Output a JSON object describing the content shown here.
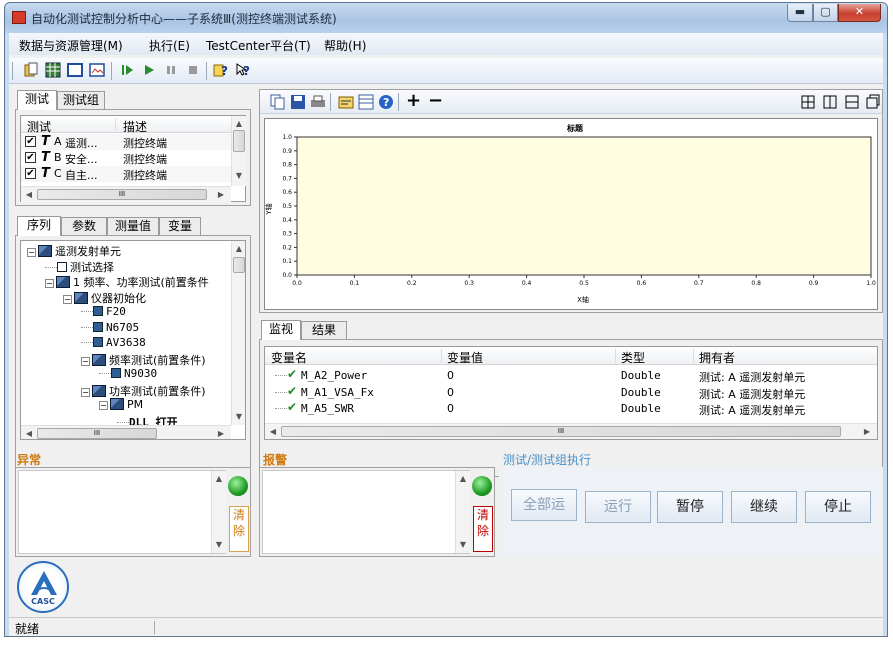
{
  "window": {
    "title": "自动化测试控制分析中心——子系统Ⅲ(测控终端测试系统)",
    "minimize": "▬",
    "maximize": "▢",
    "close": "✕"
  },
  "menu": [
    "数据与资源管理(M)",
    "执行(E)",
    "TestCenter平台(T)",
    "帮助(H)"
  ],
  "toolbar_icons": [
    "open-icon",
    "grid-icon",
    "window-icon",
    "image-icon",
    "step-run-icon",
    "run-icon",
    "pause-icon",
    "stop-icon",
    "help-icon",
    "context-help-icon"
  ],
  "test_panel": {
    "tabs": [
      "测试",
      "测试组"
    ],
    "columns": [
      "测试",
      "描述"
    ],
    "rows": [
      {
        "checked": true,
        "letter": "A",
        "name": "遥测...",
        "desc": "测控终端"
      },
      {
        "checked": true,
        "letter": "B",
        "name": "安全...",
        "desc": "测控终端"
      },
      {
        "checked": true,
        "letter": "C",
        "name": "自主...",
        "desc": "测控终端"
      }
    ]
  },
  "seq_panel": {
    "tabs": [
      "序列",
      "参数",
      "测量值",
      "变量"
    ],
    "tree": [
      {
        "text": "遥测发射单元",
        "indent": 0,
        "kind": "folder",
        "pm": "−"
      },
      {
        "text": "测试选择",
        "indent": 1,
        "kind": "box",
        "pm": ""
      },
      {
        "text": "1 频率、功率测试(前置条件",
        "indent": 1,
        "kind": "folder",
        "pm": "−"
      },
      {
        "text": "仪器初始化",
        "indent": 2,
        "kind": "folder",
        "pm": "−"
      },
      {
        "text": "F20",
        "indent": 3,
        "kind": "node",
        "pm": ""
      },
      {
        "text": "N6705",
        "indent": 3,
        "kind": "node",
        "pm": ""
      },
      {
        "text": "AV3638",
        "indent": 3,
        "kind": "node",
        "pm": ""
      },
      {
        "text": "频率测试(前置条件)",
        "indent": 3,
        "kind": "folder",
        "pm": "−"
      },
      {
        "text": "N9030",
        "indent": 4,
        "kind": "node",
        "pm": ""
      },
      {
        "text": "功率测试(前置条件)",
        "indent": 3,
        "kind": "folder",
        "pm": "−"
      },
      {
        "text": "PM",
        "indent": 4,
        "kind": "folder",
        "pm": "−"
      },
      {
        "text": "DLL 打开",
        "indent": 5,
        "kind": "dll",
        "pm": ""
      }
    ]
  },
  "chart_toolbar_icons": [
    "copy-icon",
    "save-icon",
    "print-icon",
    "properties-icon",
    "table-icon",
    "help-icon",
    "zoom-in-icon",
    "zoom-out-icon",
    "layout-1-icon",
    "layout-2-icon",
    "layout-3-icon",
    "layout-4-icon"
  ],
  "chart_data": {
    "type": "line",
    "title": "标题",
    "xlabel": "X轴",
    "ylabel": "Y轴",
    "xlim": [
      0,
      1
    ],
    "ylim": [
      0,
      1
    ],
    "xticks": [
      "0.0",
      "0.1",
      "0.2",
      "0.3",
      "0.4",
      "0.5",
      "0.6",
      "0.7",
      "0.8",
      "0.9",
      "1.0"
    ],
    "yticks": [
      "0.0",
      "0.1",
      "0.2",
      "0.3",
      "0.4",
      "0.5",
      "0.6",
      "0.7",
      "0.8",
      "0.9",
      "1.0"
    ],
    "series": [],
    "grid": false,
    "background": "#fffde0"
  },
  "monitor": {
    "tabs": [
      "监视",
      "结果"
    ],
    "columns": [
      "变量名",
      "变量值",
      "类型",
      "拥有者"
    ],
    "rows": [
      {
        "name": "M_A2_Power",
        "value": "0",
        "type": "Double",
        "owner": "测试: A 遥测发射单元"
      },
      {
        "name": "M_A1_VSA_Fx",
        "value": "0",
        "type": "Double",
        "owner": "测试: A 遥测发射单元"
      },
      {
        "name": "M_A5_SWR",
        "value": "0",
        "type": "Double",
        "owner": "测试: A 遥测发射单元"
      }
    ]
  },
  "exception": {
    "label": "异常",
    "clear": "清除"
  },
  "alarm": {
    "label": "报警",
    "clear": "清除"
  },
  "execution": {
    "label": "测试/测试组执行",
    "buttons": [
      "全部运",
      "运行",
      "暂停",
      "继续",
      "停止"
    ]
  },
  "logo": {
    "text": "CASC"
  },
  "status": {
    "text": "就绪"
  },
  "colors": {
    "accent": "#1e9b24",
    "section_label": "#d07a10",
    "clear_red": "#c00000"
  }
}
